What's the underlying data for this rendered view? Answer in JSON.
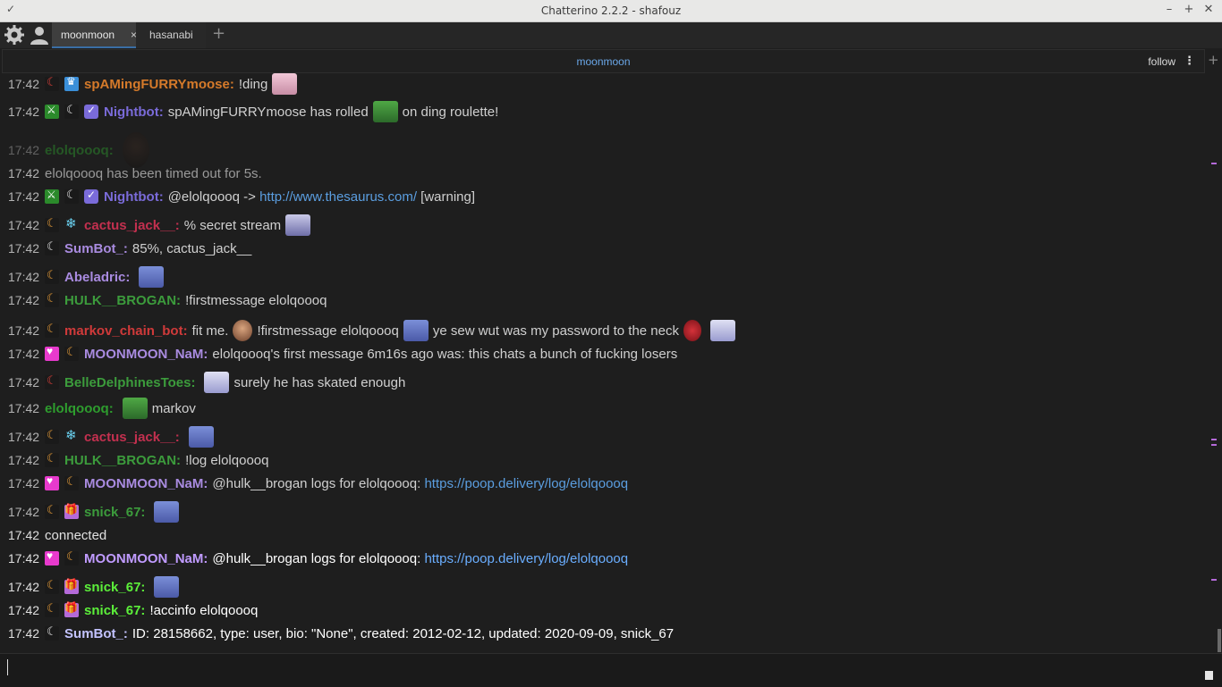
{
  "window": {
    "title": "Chatterino 2.2.2 - shafouz"
  },
  "tabs": [
    {
      "label": "moonmoon",
      "close": "×"
    },
    {
      "label": "hasanabi"
    }
  ],
  "add_tab": "+",
  "split": {
    "channel": "moonmoon",
    "follow": "follow",
    "more": "⋮",
    "add": "+"
  },
  "colors": {
    "accent": "#3a6ea5",
    "link": "#5b9ee0",
    "name_orange": "#d57a2a",
    "name_purple": "#7a6bd9",
    "name_green": "#2e9d2e",
    "name_teal": "#3c9c6a",
    "name_magenta": "#c3304f",
    "name_violet": "#a98be0",
    "name_lightgreen": "#5cf03a",
    "name_red": "#d03a3a"
  },
  "messages": [
    {
      "time": "17:42",
      "name": "spAMingFURRYmoose:",
      "text": "!ding"
    },
    {
      "time": "17:42",
      "name": "Nightbot:",
      "text": "spAMingFURRYmoose has rolled",
      "text2": "on ding roulette!"
    },
    {
      "time": "17:42",
      "name": "elolqoooq:"
    },
    {
      "time": "17:42",
      "text": "elolqoooq has been timed out for 5s."
    },
    {
      "time": "17:42",
      "name": "Nightbot:",
      "text": "@elolqoooq ->",
      "link": "http://www.thesaurus.com/",
      "text2": "[warning]"
    },
    {
      "time": "17:42",
      "name": "cactus_jack__:",
      "text": "% secret stream"
    },
    {
      "time": "17:42",
      "name": "SumBot_:",
      "text": "85%, cactus_jack__"
    },
    {
      "time": "17:42",
      "name": "Abeladric:"
    },
    {
      "time": "17:42",
      "name": "HULK__BROGAN:",
      "text": "!firstmessage elolqoooq"
    },
    {
      "time": "17:42",
      "name": "markov_chain_bot:",
      "text": "fit me.",
      "text2": "!firstmessage elolqoooq",
      "text3": "ye sew wut was my password to the neck"
    },
    {
      "time": "17:42",
      "name": "MOONMOON_NaM:",
      "text": "elolqoooq's first message 6m16s ago was: this chats a bunch of fucking losers"
    },
    {
      "time": "17:42",
      "name": "BelleDelphinesToes:",
      "text": "surely he has skated enough"
    },
    {
      "time": "17:42",
      "name": "elolqoooq:",
      "text": "markov"
    },
    {
      "time": "17:42",
      "name": "cactus_jack__:"
    },
    {
      "time": "17:42",
      "name": "HULK__BROGAN:",
      "text": "!log elolqoooq"
    },
    {
      "time": "17:42",
      "name": "MOONMOON_NaM:",
      "text": "@hulk__brogan logs for elolqoooq:",
      "link": "https://poop.delivery/log/elolqoooq"
    },
    {
      "time": "17:42",
      "name": "snick_67:"
    },
    {
      "time": "17:42",
      "text": "connected"
    },
    {
      "time": "17:42",
      "name": "MOONMOON_NaM:",
      "text": "@hulk__brogan logs for elolqoooq:",
      "link": "https://poop.delivery/log/elolqoooq"
    },
    {
      "time": "17:42",
      "name": "snick_67:"
    },
    {
      "time": "17:42",
      "name": "snick_67:",
      "text": "!accinfo elolqoooq"
    },
    {
      "time": "17:42",
      "name": "SumBot_:",
      "text": "ID: 28158662, type: user, bio: \"None\", created: 2012-02-12, updated: 2020-09-09, snick_67"
    }
  ]
}
